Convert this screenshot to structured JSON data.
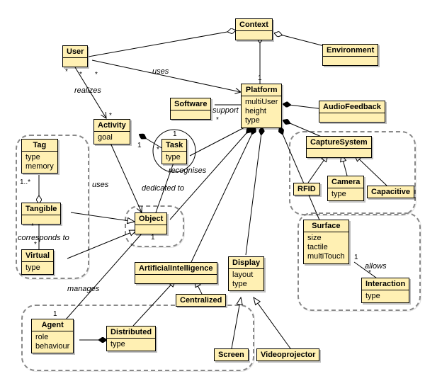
{
  "diagram_type": "UML Class Diagram",
  "classes": {
    "context": {
      "name": "Context",
      "attrs": []
    },
    "user": {
      "name": "User",
      "attrs": []
    },
    "environment": {
      "name": "Environment",
      "attrs": []
    },
    "platform": {
      "name": "Platform",
      "attrs": [
        "multiUser",
        "height",
        "type"
      ]
    },
    "software": {
      "name": "Software",
      "attrs": []
    },
    "audiofeedback": {
      "name": "AudioFeedback",
      "attrs": []
    },
    "activity": {
      "name": "Activity",
      "attrs": [
        "goal"
      ]
    },
    "task": {
      "name": "Task",
      "attrs": [
        "type"
      ]
    },
    "capturesystem": {
      "name": "CaptureSystem",
      "attrs": []
    },
    "rfid": {
      "name": "RFID",
      "attrs": []
    },
    "camera": {
      "name": "Camera",
      "attrs": [
        "type"
      ]
    },
    "capacitive": {
      "name": "Capacitive",
      "attrs": []
    },
    "tag": {
      "name": "Tag",
      "attrs": [
        "type",
        "memory"
      ]
    },
    "tangible": {
      "name": "Tangible",
      "attrs": []
    },
    "virtual": {
      "name": "Virtual",
      "attrs": [
        "type"
      ]
    },
    "object": {
      "name": "Object",
      "attrs": []
    },
    "surface": {
      "name": "Surface",
      "attrs": [
        "size",
        "tactile",
        "multiTouch"
      ]
    },
    "display": {
      "name": "Display",
      "attrs": [
        "layout",
        "type"
      ]
    },
    "interaction": {
      "name": "Interaction",
      "attrs": [
        "type"
      ]
    },
    "ai": {
      "name": "ArtificialIntelligence",
      "attrs": []
    },
    "distributed": {
      "name": "Distributed",
      "attrs": [
        "type"
      ]
    },
    "centralized": {
      "name": "Centralized",
      "attrs": []
    },
    "screen": {
      "name": "Screen",
      "attrs": []
    },
    "videoprojector": {
      "name": "Videoprojector",
      "attrs": []
    },
    "agent": {
      "name": "Agent",
      "attrs": [
        "role",
        "behaviour"
      ]
    }
  },
  "labels": {
    "uses1": "uses",
    "realizes": "realizes",
    "support": "support",
    "recognises": "recognises",
    "dedicatedto": "dedicated to",
    "uses2": "uses",
    "correspondsto": "corresponds to",
    "manages": "manages",
    "allows": "allows"
  },
  "multiplicities": {
    "star": "*",
    "one": "1",
    "oneplus": "1..*"
  }
}
